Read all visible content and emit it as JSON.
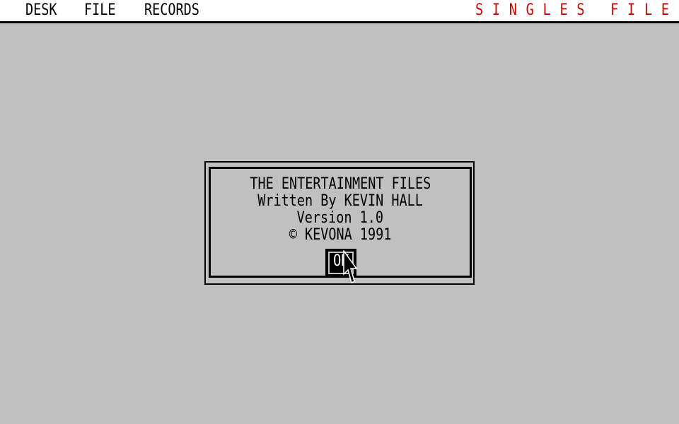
{
  "menubar": {
    "items": [
      {
        "label": "DESK"
      },
      {
        "label": "FILE"
      },
      {
        "label": "RECORDS"
      }
    ],
    "app_title": "SINGLES FILE",
    "app_title_color": "#cc0000"
  },
  "dialog": {
    "lines": [
      "THE ENTERTAINMENT FILES",
      "Written By KEVIN HALL",
      "Version 1.0",
      "© KEVONA 1991"
    ],
    "ok_label": "OK"
  },
  "cursor": {
    "icon": "arrow-pointer-icon"
  },
  "colors": {
    "desktop": "#c0c0c0",
    "menubar": "#ffffff",
    "text": "#000000"
  }
}
